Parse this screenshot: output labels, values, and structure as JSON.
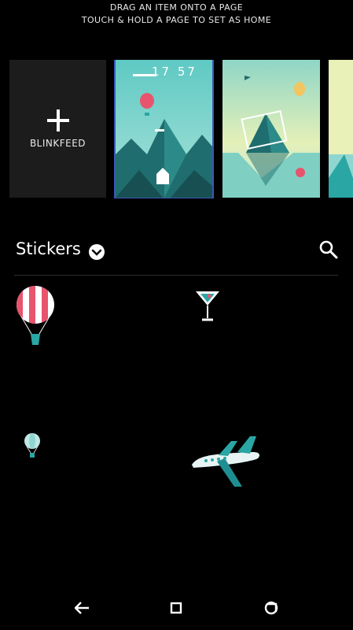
{
  "header": {
    "line1": "DRAG AN ITEM ONTO A PAGE",
    "line2": "TOUCH & HOLD A PAGE TO SET AS HOME"
  },
  "pages": {
    "blinkfeed_label": "BLINKFEED",
    "home_clock": "17 57"
  },
  "stickers": {
    "title": "Stickers",
    "items": [
      "hot-air-balloon",
      "cocktail-glass",
      "small-balloon",
      "airplane"
    ]
  },
  "colors": {
    "teal": "#2aa6a4",
    "sky": "#8fd6d0",
    "accent_pink": "#e8546d",
    "selected_outline": "#3c57b8"
  },
  "navbar": {
    "buttons": [
      "back-icon",
      "home-icon",
      "recents-icon"
    ]
  }
}
